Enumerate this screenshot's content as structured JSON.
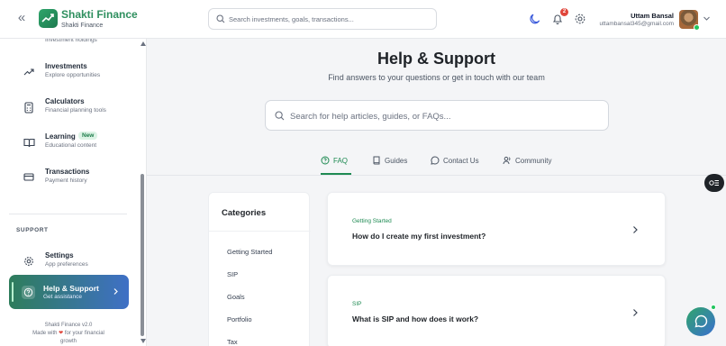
{
  "header": {
    "brand_name": "Shakti Finance",
    "brand_sub": "Shakti Finance",
    "search_placeholder": "Search investments, goals, transactions...",
    "notification_count": "2",
    "user_name": "Uttam Bansal",
    "user_email": "uttambansal345@gmail.com"
  },
  "sidebar": {
    "cut_item_sub": "Investment holdings",
    "items": [
      {
        "title": "Investments",
        "sub": "Explore opportunities",
        "icon": "trending-up-icon"
      },
      {
        "title": "Calculators",
        "sub": "Financial planning tools",
        "icon": "calculator-icon"
      },
      {
        "title": "Learning",
        "sub": "Educational content",
        "badge": "New",
        "icon": "book-icon"
      },
      {
        "title": "Transactions",
        "sub": "Payment history",
        "icon": "credit-card-icon"
      }
    ],
    "support_label": "SUPPORT",
    "settings": {
      "title": "Settings",
      "sub": "App preferences"
    },
    "help": {
      "title": "Help & Support",
      "sub": "Get assistance"
    },
    "footer_version": "Shakti Finance v2.0",
    "footer_made_pre": "Made with",
    "footer_made_post": "for your financial",
    "footer_made_end": "growth"
  },
  "main": {
    "title": "Help & Support",
    "subtitle": "Find answers to your questions or get in touch with our team",
    "search_placeholder": "Search for help articles, guides, or FAQs...",
    "tabs": [
      {
        "label": "FAQ",
        "active": true
      },
      {
        "label": "Guides",
        "active": false
      },
      {
        "label": "Contact Us",
        "active": false
      },
      {
        "label": "Community",
        "active": false
      }
    ],
    "categories_title": "Categories",
    "categories": [
      "Getting Started",
      "SIP",
      "Goals",
      "Portfolio",
      "Tax"
    ],
    "faqs": [
      {
        "category": "Getting Started",
        "question": "How do I create my first investment?"
      },
      {
        "category": "SIP",
        "question": "What is SIP and how does it work?"
      }
    ]
  },
  "colors": {
    "accent": "#1e8a52",
    "brand": "#2e8f5e",
    "notification": "#e0463b"
  }
}
